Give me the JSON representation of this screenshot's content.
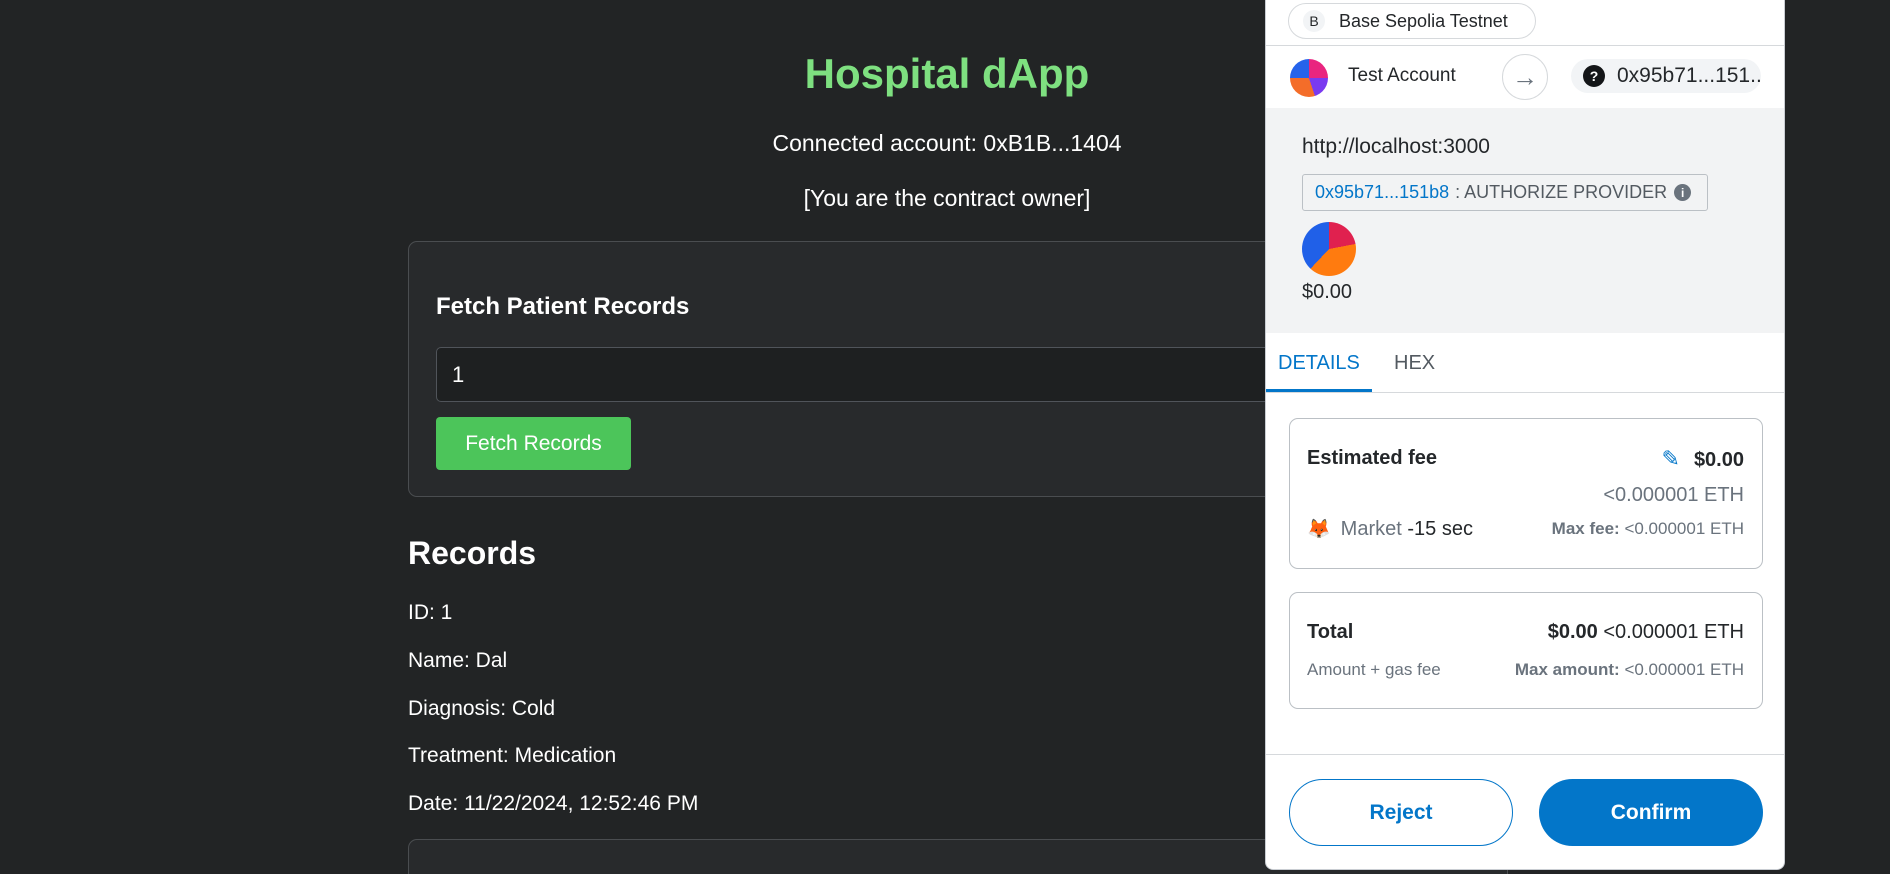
{
  "app": {
    "title": "Hospital dApp",
    "connected_account": "Connected account: 0xB1B...1404",
    "owner_note": "[You are the contract owner]",
    "fetch_card": {
      "heading": "Fetch Patient Records",
      "input_value": "1",
      "button_label": "Fetch Records"
    },
    "records": {
      "heading": "Records",
      "lines": [
        "ID: 1",
        "Name: Dal",
        "Diagnosis: Cold",
        "Treatment: Medication",
        "Date: 11/22/2024, 12:52:46 PM"
      ]
    }
  },
  "wallet": {
    "network": {
      "letter": "B",
      "name": "Base Sepolia Testnet"
    },
    "account_name": "Test Account",
    "arrow": "→",
    "recipient": {
      "icon": "?",
      "address": "0x95b71...151..."
    },
    "origin": "http://localhost:3000",
    "method": {
      "address": "0x95b71...151b8",
      "text": ": AUTHORIZE PROVIDER",
      "info": "i"
    },
    "token_value": "$0.00",
    "tabs": [
      "DETAILS",
      "HEX"
    ],
    "estimated_fee": {
      "label": "Estimated fee",
      "edit_icon": "✎",
      "fiat": "$0.00",
      "eth": "<0.000001 ETH",
      "speed_icon": "🦊",
      "speed": "Market",
      "time": "-15 sec",
      "max_fee_label": "Max fee:",
      "max_fee_value": "<0.000001 ETH"
    },
    "total": {
      "label": "Total",
      "fiat": "$0.00",
      "eth": "<0.000001 ETH",
      "sub_label": "Amount + gas fee",
      "max_amount_label": "Max amount:",
      "max_amount_value": "<0.000001 ETH"
    },
    "reject_label": "Reject",
    "confirm_label": "Confirm"
  },
  "colors": {
    "page_bg": "#222425",
    "title_green": "#7ee080",
    "fetch_button": "#4cc55a",
    "wallet_primary": "#0376c9"
  }
}
